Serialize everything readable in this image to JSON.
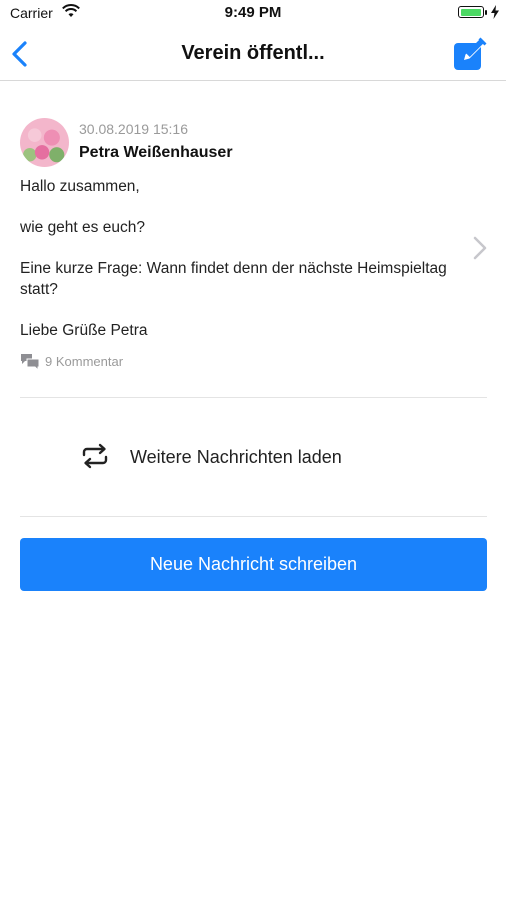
{
  "status_bar": {
    "carrier": "Carrier",
    "time": "9:49 PM",
    "battery_level": 1.0
  },
  "nav": {
    "title": "Verein öffentl...",
    "back_icon": "chevron-left-icon",
    "compose_icon": "compose-icon"
  },
  "post": {
    "date": "30.08.2019 15:16",
    "author": "Petra Weißenhauser",
    "body": [
      "Hallo zusammen,",
      "wie geht es euch?",
      "Eine kurze Frage: Wann findet denn der nächste Heimspieltag statt?",
      "Liebe Grüße Petra"
    ],
    "comments": "9 Kommentar"
  },
  "load_more": {
    "label": "Weitere Nachrichten laden"
  },
  "actions": {
    "new_message_label": "Neue Nachricht schreiben"
  },
  "colors": {
    "accent": "#1a82fb",
    "muted_text": "#9a9a9a",
    "divider": "#e4e4e4"
  }
}
